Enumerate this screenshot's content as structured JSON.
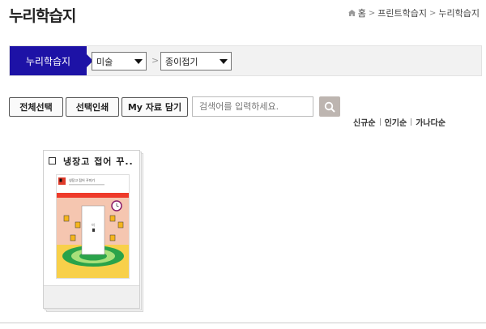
{
  "page": {
    "title": "누리학습지"
  },
  "breadcrumb": {
    "home_icon": "home-icon",
    "items": [
      "홈",
      "프린트학습지",
      "누리학습지"
    ]
  },
  "filter": {
    "home_label": "누리학습지",
    "category": "미술",
    "subcategory": "종이접기"
  },
  "actions": {
    "select_all": "전체선택",
    "print_selected": "선택인쇄",
    "save_my": "My 자료 담기"
  },
  "search": {
    "placeholder": "검색어를 입력하세요.",
    "icon": "search-icon"
  },
  "sort": {
    "newest": "신규순",
    "popular": "인기순",
    "alphabetical": "가나다순"
  },
  "cards": [
    {
      "title": "냉장고 접어 꾸..",
      "thumb_heading": "냉장고 접어 꾸미기",
      "door_text": "미"
    }
  ],
  "colors": {
    "accent": "#1d12a6",
    "search_button": "#bdb5b0"
  }
}
